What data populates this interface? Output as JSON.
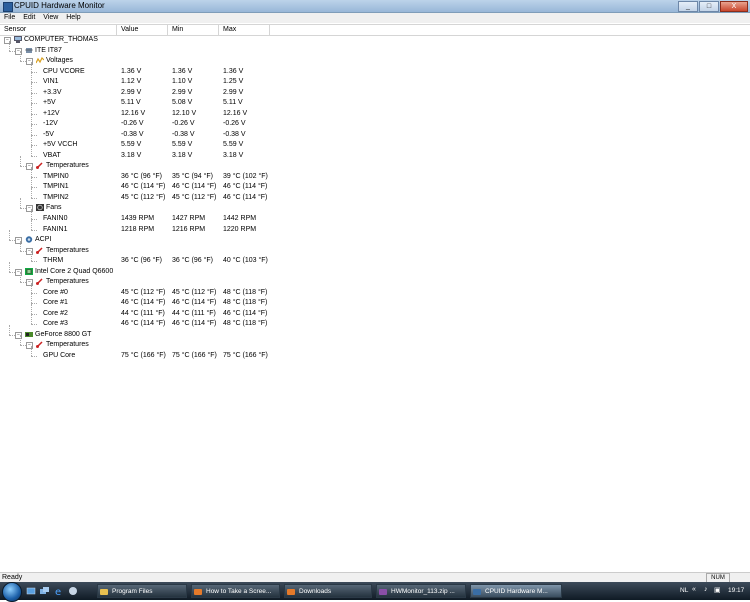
{
  "window": {
    "title": "CPUID Hardware Monitor",
    "buttons": {
      "minimize": "_",
      "maximize": "□",
      "close": "X"
    }
  },
  "menu": [
    "File",
    "Edit",
    "View",
    "Help"
  ],
  "columns": [
    "Sensor",
    "Value",
    "Min",
    "Max"
  ],
  "tree": [
    {
      "level": 0,
      "kind": "computer",
      "label": "COMPUTER_THOMAS"
    },
    {
      "level": 1,
      "kind": "chip",
      "label": "ITE IT87"
    },
    {
      "level": 2,
      "kind": "voltage",
      "label": "Voltages"
    },
    {
      "level": 3,
      "kind": "sensor",
      "label": "CPU VCORE",
      "value": "1.36 V",
      "min": "1.36 V",
      "max": "1.36 V"
    },
    {
      "level": 3,
      "kind": "sensor",
      "label": "VIN1",
      "value": "1.12 V",
      "min": "1.10 V",
      "max": "1.25 V"
    },
    {
      "level": 3,
      "kind": "sensor",
      "label": "+3.3V",
      "value": "2.99 V",
      "min": "2.99 V",
      "max": "2.99 V"
    },
    {
      "level": 3,
      "kind": "sensor",
      "label": "+5V",
      "value": "5.11 V",
      "min": "5.08 V",
      "max": "5.11 V"
    },
    {
      "level": 3,
      "kind": "sensor",
      "label": "+12V",
      "value": "12.16 V",
      "min": "12.10 V",
      "max": "12.16 V"
    },
    {
      "level": 3,
      "kind": "sensor",
      "label": "-12V",
      "value": "-0.26 V",
      "min": "-0.26 V",
      "max": "-0.26 V"
    },
    {
      "level": 3,
      "kind": "sensor",
      "label": "-5V",
      "value": "-0.38 V",
      "min": "-0.38 V",
      "max": "-0.38 V"
    },
    {
      "level": 3,
      "kind": "sensor",
      "label": "+5V VCCH",
      "value": "5.59 V",
      "min": "5.59 V",
      "max": "5.59 V"
    },
    {
      "level": 3,
      "kind": "sensor",
      "label": "VBAT",
      "value": "3.18 V",
      "min": "3.18 V",
      "max": "3.18 V"
    },
    {
      "level": 2,
      "kind": "temp",
      "label": "Temperatures"
    },
    {
      "level": 3,
      "kind": "sensor",
      "label": "TMPIN0",
      "value": "36 °C  (96 °F)",
      "min": "35 °C  (94 °F)",
      "max": "39 °C  (102 °F)"
    },
    {
      "level": 3,
      "kind": "sensor",
      "label": "TMPIN1",
      "value": "46 °C  (114 °F)",
      "min": "46 °C  (114 °F)",
      "max": "46 °C  (114 °F)"
    },
    {
      "level": 3,
      "kind": "sensor",
      "label": "TMPIN2",
      "value": "45 °C  (112 °F)",
      "min": "45 °C  (112 °F)",
      "max": "46 °C  (114 °F)"
    },
    {
      "level": 2,
      "kind": "fan",
      "label": "Fans"
    },
    {
      "level": 3,
      "kind": "sensor",
      "label": "FANIN0",
      "value": "1439 RPM",
      "min": "1427 RPM",
      "max": "1442 RPM"
    },
    {
      "level": 3,
      "kind": "sensor",
      "label": "FANIN1",
      "value": "1218 RPM",
      "min": "1216 RPM",
      "max": "1220 RPM"
    },
    {
      "level": 1,
      "kind": "acpi",
      "label": "ACPI"
    },
    {
      "level": 2,
      "kind": "temp",
      "label": "Temperatures"
    },
    {
      "level": 3,
      "kind": "sensor",
      "label": "THRM",
      "value": "36 °C  (96 °F)",
      "min": "36 °C  (96 °F)",
      "max": "40 °C  (103 °F)"
    },
    {
      "level": 1,
      "kind": "cpu",
      "label": "Intel Core 2 Quad Q6600"
    },
    {
      "level": 2,
      "kind": "temp",
      "label": "Temperatures"
    },
    {
      "level": 3,
      "kind": "sensor",
      "label": "Core #0",
      "value": "45 °C  (112 °F)",
      "min": "45 °C  (112 °F)",
      "max": "48 °C  (118 °F)"
    },
    {
      "level": 3,
      "kind": "sensor",
      "label": "Core #1",
      "value": "46 °C  (114 °F)",
      "min": "46 °C  (114 °F)",
      "max": "48 °C  (118 °F)"
    },
    {
      "level": 3,
      "kind": "sensor",
      "label": "Core #2",
      "value": "44 °C  (111 °F)",
      "min": "44 °C  (111 °F)",
      "max": "46 °C  (114 °F)"
    },
    {
      "level": 3,
      "kind": "sensor",
      "label": "Core #3",
      "value": "46 °C  (114 °F)",
      "min": "46 °C  (114 °F)",
      "max": "48 °C  (118 °F)"
    },
    {
      "level": 1,
      "kind": "gpu",
      "label": "GeForce 8800 GT"
    },
    {
      "level": 2,
      "kind": "temp",
      "label": "Temperatures"
    },
    {
      "level": 3,
      "kind": "sensor",
      "label": "GPU Core",
      "value": "75 °C  (166 °F)",
      "min": "75 °C  (166 °F)",
      "max": "75 °C  (166 °F)"
    }
  ],
  "status": {
    "text": "Ready",
    "num": "NUM"
  },
  "taskbar": {
    "tasks": [
      {
        "label": "Program Files",
        "icon": "folder-icon",
        "active": false
      },
      {
        "label": "How to Take a Scree...",
        "icon": "firefox-icon",
        "active": false
      },
      {
        "label": "Downloads",
        "icon": "firefox-icon",
        "active": false
      },
      {
        "label": "HWMonitor_113.zip ...",
        "icon": "winrar-icon",
        "active": false
      },
      {
        "label": "CPUID Hardware M...",
        "icon": "cpuid-icon",
        "active": true
      }
    ],
    "tray": {
      "lang": "NL",
      "time": "19:17"
    }
  },
  "colors": {
    "voltage_icon": "#d8a020",
    "temp_icon": "#cc2222",
    "fan_icon": "#333333",
    "chip_icon": "#7a8fa8"
  }
}
